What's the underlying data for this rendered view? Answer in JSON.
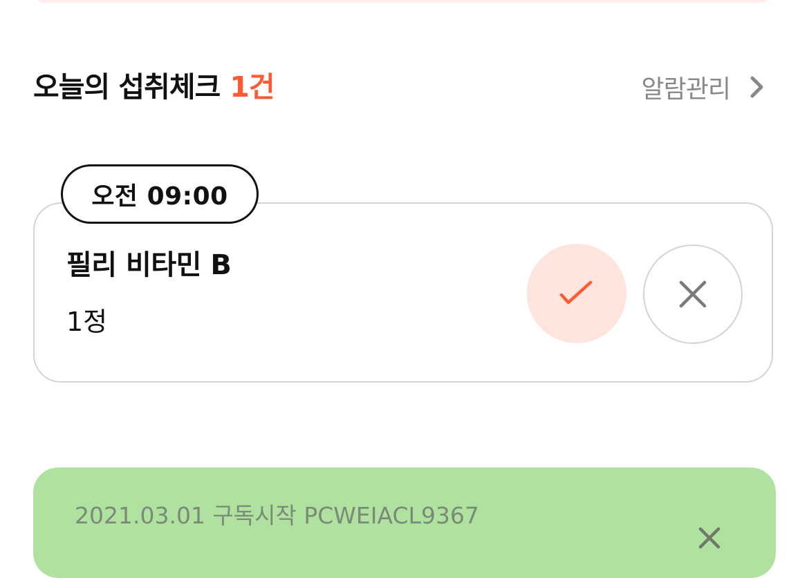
{
  "section": {
    "title": "오늘의 섭취체크",
    "count": "1건",
    "alarm_label": "알람관리"
  },
  "intake": {
    "time": "오전 09:00",
    "name": "필리 비타민 B",
    "dose": "1정"
  },
  "subscription": {
    "text": "2021.03.01 구독시작 PCWEIACL9367"
  },
  "colors": {
    "accent": "#ff5a36",
    "check_bg": "#fde4dd",
    "subscription_bg": "#b0e29f",
    "muted": "#888888"
  },
  "icons": {
    "alarm_arrow": "chevron-right-icon",
    "taken": "check-icon",
    "skip": "close-icon",
    "dismiss": "close-icon"
  }
}
